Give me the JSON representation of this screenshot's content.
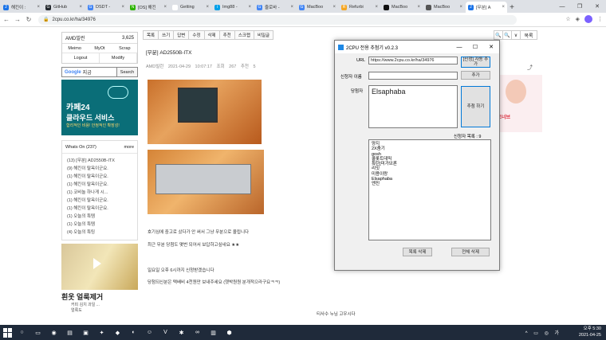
{
  "browser": {
    "tabs": [
      {
        "title": "해킨이 :",
        "color": "#1a73e8",
        "icon": "2"
      },
      {
        "title": "GitHub",
        "color": "#24292e",
        "icon": "G"
      },
      {
        "title": "DSDT -",
        "color": "#4285f4",
        "icon": "G"
      },
      {
        "title": "[OS] 해킨",
        "color": "#2db400",
        "icon": "N"
      },
      {
        "title": "Getting",
        "color": "#ffffff",
        "icon": "✦"
      },
      {
        "title": "Img88 -",
        "color": "#00a0e9",
        "icon": "i"
      },
      {
        "title": "줄로바 -",
        "color": "#4285f4",
        "icon": "G"
      },
      {
        "title": "MacBoo",
        "color": "#4285f4",
        "icon": "G"
      },
      {
        "title": "Refurbi",
        "color": "#f5a623",
        "icon": "R"
      },
      {
        "title": "MacBoo",
        "color": "#111111",
        "icon": ""
      },
      {
        "title": "MacBoo",
        "color": "#555555",
        "icon": ""
      },
      {
        "title": "[무분] A",
        "color": "#1a73e8",
        "icon": "2",
        "active": true
      }
    ],
    "url": "2cpu.co.kr/ha/34976"
  },
  "sidebar": {
    "username": "AMD빌런",
    "points": "3,625",
    "menu1": [
      "Meimo",
      "MyOt",
      "Scrap"
    ],
    "menu2": [
      "Logout",
      "Modify"
    ],
    "search_brand": "Google",
    "search_suffix": "지금",
    "search_button": "Search",
    "ad1_title": "카페24",
    "ad1_subtitle": "클라우드 서비스",
    "ad1_small": "합리적인 비용! 안정적인 확장성!",
    "whats_on": "Whats On (237)",
    "more": "more",
    "items": [
      "(13) [무분] AD2550B-ITX",
      "(9) 해킨이 탈옥이군요.",
      "(1) 해킨이 탈옥이군요.",
      "(1) 해킨이 탈옥이군요.",
      "(1) 코비놀 하나게 시...",
      "(1) 해킨이 탈옥이군요.",
      "(1) 해킨이 탈옥이군요.",
      "(1) 오늘의 특템",
      "(1) 오늘의 특템",
      "(4) 오늘의 특팅"
    ],
    "ad2_title": "흰옷 얼룩제거",
    "ad2_sub": "커피 김치 과일 ...",
    "ad2_sub2": "얼룩도 "
  },
  "post": {
    "toolbar": [
      "목록",
      "쓰기",
      "답변",
      "수정",
      "삭제",
      "추천",
      "스크랩",
      "비밀글"
    ],
    "toolbar_right": [
      "🔍",
      "🔍",
      "∨",
      "목록"
    ],
    "title": "[무분] AD2550B-ITX",
    "meta_author": "AMD빌런",
    "meta_date": "2021-04-29 10:07:17",
    "meta_views": "조회 267",
    "meta_rec": "추천 5",
    "line1": "호기심에 중고로 샀다가 안 써서 그냥 무분으로 올립니다",
    "line2": "최근 무분 당첨도 몇번 되어서 보답하고싶네요 ★★",
    "line3": "일요일 오후 6시까지 신청받겠습니다",
    "line4": "당첨되신분은 택배비 4천원만 보내주세요 (헷박원원 분개적으라구요ㅋㅋ)",
    "line5": "티사수 누님 고우시다",
    "right_ad_text": "아트너브"
  },
  "extractor": {
    "title": "2CPU 전용 추첨기 v0.2.3",
    "url_label": "URL",
    "url_value": "https://www.2cpu.co.kr/ha/34976",
    "auto_add_button": "[신청] 자동 추가",
    "applicant_label": "신청자 이름",
    "add_button": "추가",
    "winner_label": "당첨자",
    "winner_value": "Elsaphaba",
    "draw_button": "추첨 하기",
    "list_label": "신청자 목록 : 9",
    "list": [
      "양지",
      "2X춤기",
      "gosh",
      "콜롯트데믹",
      "특탄[미가브론",
      "리잇",
      "미용이랑",
      "Elsaphaba",
      "엔진"
    ],
    "delete_button": "목록 삭제",
    "delete_all_button": "전체 삭제"
  },
  "taskbar": {
    "time": "오후 5:30",
    "date": "2021-04-25"
  }
}
